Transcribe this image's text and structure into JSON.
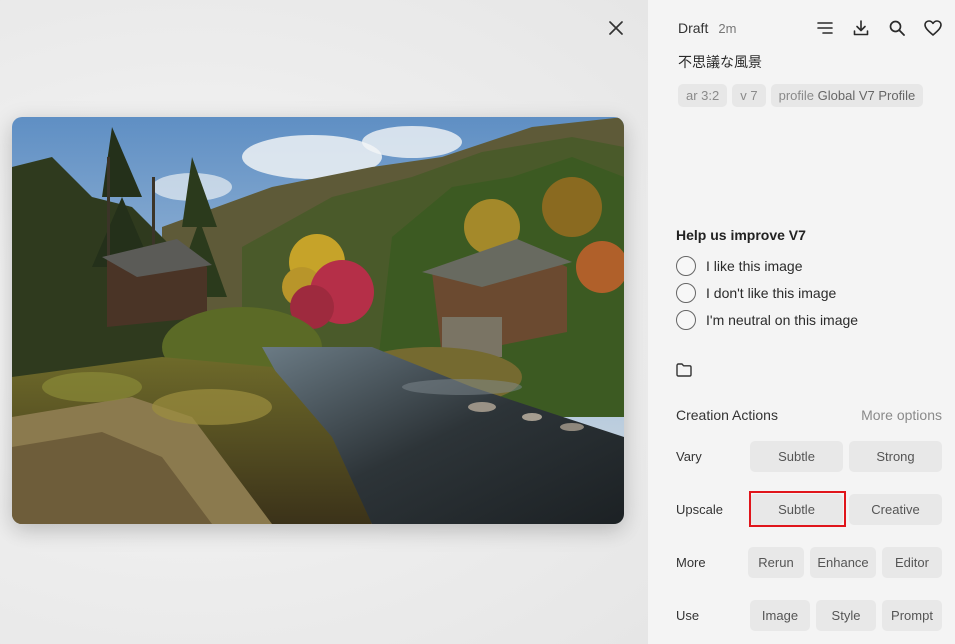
{
  "header": {
    "status": "Draft",
    "age": "2m",
    "icons": [
      "menu-icon",
      "download-icon",
      "search-icon",
      "heart-icon"
    ]
  },
  "prompt": "不思議な風景",
  "tags": [
    {
      "text": "ar 3:2"
    },
    {
      "text": "v 7"
    },
    {
      "prefix": "profile",
      "value": "Global V7 Profile"
    }
  ],
  "feedback": {
    "title": "Help us improve V7",
    "options": [
      "I like this image",
      "I don't like this image",
      "I'm neutral on this image"
    ]
  },
  "creation_actions": {
    "title": "Creation Actions",
    "more_options": "More options",
    "rows": [
      {
        "label": "Vary",
        "buttons": [
          "Subtle",
          "Strong"
        ]
      },
      {
        "label": "Upscale",
        "buttons": [
          "Subtle",
          "Creative"
        ]
      },
      {
        "label": "More",
        "buttons": [
          "Rerun",
          "Enhance",
          "Editor"
        ]
      },
      {
        "label": "Use",
        "buttons": [
          "Image",
          "Style",
          "Prompt"
        ]
      }
    ]
  },
  "colors": {
    "highlight": "#e0151b",
    "panel_bg": "#f4f4f4",
    "button_bg": "#e8e8e8"
  }
}
